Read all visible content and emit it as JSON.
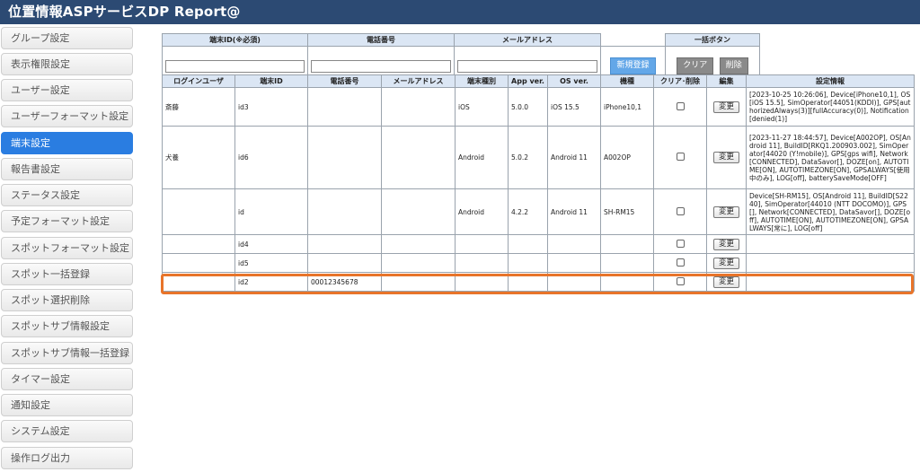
{
  "app": {
    "title": "位置情報ASPサービスDP Report@"
  },
  "sidebar": {
    "items": [
      {
        "label": "グループ設定",
        "active": false
      },
      {
        "label": "表示権限設定",
        "active": false
      },
      {
        "label": "ユーザー設定",
        "active": false
      },
      {
        "label": "ユーザーフォーマット設定",
        "active": false
      },
      {
        "label": "端末設定",
        "active": true
      },
      {
        "label": "報告書設定",
        "active": false
      },
      {
        "label": "ステータス設定",
        "active": false
      },
      {
        "label": "予定フォーマット設定",
        "active": false
      },
      {
        "label": "スポットフォーマット設定",
        "active": false
      },
      {
        "label": "スポット一括登録",
        "active": false
      },
      {
        "label": "スポット選択削除",
        "active": false
      },
      {
        "label": "スポットサブ情報設定",
        "active": false
      },
      {
        "label": "スポットサブ情報一括登録",
        "active": false
      },
      {
        "label": "タイマー設定",
        "active": false
      },
      {
        "label": "通知設定",
        "active": false
      },
      {
        "label": "システム設定",
        "active": false
      },
      {
        "label": "操作ログ出力",
        "active": false
      }
    ]
  },
  "search": {
    "headers": {
      "terminal_id": "端末ID(※必須)",
      "phone": "電話番号",
      "mail": "メールアドレス",
      "bulk": "一括ボタン"
    },
    "values": {
      "terminal_id": "",
      "phone": "",
      "mail": ""
    },
    "new_button": "新規登録",
    "clear_button": "クリア",
    "delete_button": "削除"
  },
  "table": {
    "headers": [
      "ログインユーザ",
      "端末ID",
      "電話番号",
      "メールアドレス",
      "端末種別",
      "App ver.",
      "OS ver.",
      "機種",
      "クリア･削除",
      "編集",
      "設定情報"
    ],
    "edit_label": "変更",
    "rows": [
      {
        "user": "斎藤",
        "terminal_id": "id3",
        "phone": "",
        "mail": "",
        "type": "iOS",
        "app_ver": "5.0.0",
        "os_ver": "iOS 15.5",
        "model": "iPhone10,1",
        "info": "[2023-10-25 10:26:06], Device[iPhone10,1], OS[iOS 15.5], SimOperator[44051(KDDI)], GPS[authorizedAlways(3)][fullAccuracy(0)], Notification[denied(1)]"
      },
      {
        "user": "犬養",
        "terminal_id": "id6",
        "phone": "",
        "mail": "",
        "type": "Android",
        "app_ver": "5.0.2",
        "os_ver": "Android 11",
        "model": "A002OP",
        "info": "[2023-11-27 18:44:57], Device[A002OP], OS[Android 11], BuildID[RKQ1.200903.002], SimOperator[44020 (Y!mobile)], GPS[gps wifi], Network[CONNECTED], DataSavor[], DOZE[on], AUTOTIME[ON], AUTOTIMEZONE[ON], GPSALWAYS[使用中のみ], LOG[off], batterySaveMode[OFF]"
      },
      {
        "user": "",
        "terminal_id": "id",
        "phone": "",
        "mail": "",
        "type": "Android",
        "app_ver": "4.2.2",
        "os_ver": "Android 11",
        "model": "SH-RM15",
        "info": "Device[SH-RM15], OS[Android 11], BuildID[S2240], SimOperator[44010 (NTT DOCOMO)], GPS[], Network[CONNECTED], DataSavor[], DOZE[off], AUTOTIME[ON], AUTOTIMEZONE[ON], GPSALWAYS[常に], LOG[off]"
      },
      {
        "user": "",
        "terminal_id": "id4",
        "phone": "",
        "mail": "",
        "type": "",
        "app_ver": "",
        "os_ver": "",
        "model": "",
        "info": ""
      },
      {
        "user": "",
        "terminal_id": "id5",
        "phone": "",
        "mail": "",
        "type": "",
        "app_ver": "",
        "os_ver": "",
        "model": "",
        "info": ""
      },
      {
        "user": "",
        "terminal_id": "id2",
        "phone": "00012345678",
        "mail": "",
        "type": "",
        "app_ver": "",
        "os_ver": "",
        "model": "",
        "info": ""
      }
    ]
  },
  "colors": {
    "header_bar": "#2c4a73",
    "accent": "#2a7de1",
    "highlight": "#e8742a",
    "table_header": "#dbe6f4"
  }
}
